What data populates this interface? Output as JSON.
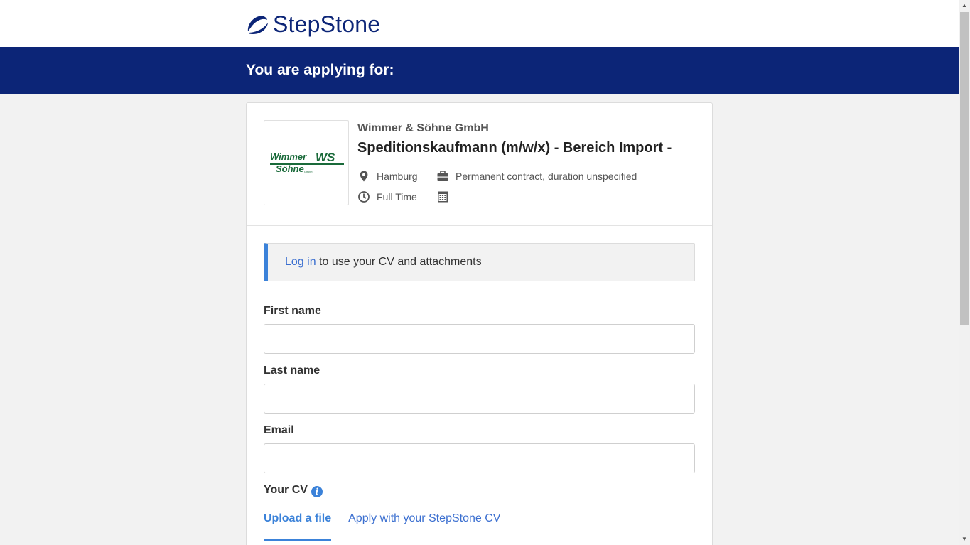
{
  "brand": {
    "name": "StepStone",
    "color": "#0c2577",
    "accent": "#3b82d9"
  },
  "banner": {
    "title": "You are applying for:"
  },
  "job": {
    "company": "Wimmer & Söhne GmbH",
    "title": "Speditionskaufmann (m/w/x) - Bereich Import -",
    "location": "Hamburg",
    "contract": "Permanent contract, duration unspecified",
    "hours": "Full Time",
    "logo": {
      "line1": "Wimmer",
      "line2": "Söhne",
      "mark": "WS",
      "small": "GmbH"
    }
  },
  "notice": {
    "link": "Log in",
    "text": " to use your CV and attachments"
  },
  "form": {
    "first_name_label": "First name",
    "last_name_label": "Last name",
    "email_label": "Email",
    "cv_label": "Your CV",
    "first_name_value": "",
    "last_name_value": "",
    "email_value": ""
  },
  "cv_tabs": [
    {
      "label": "Upload a file",
      "active": true
    },
    {
      "label": "Apply with your StepStone CV",
      "active": false
    }
  ],
  "icons": {
    "location": "map-pin-icon",
    "contract": "briefcase-icon",
    "hours": "clock-icon",
    "calendar": "calendar-icon",
    "info": "info-icon"
  }
}
